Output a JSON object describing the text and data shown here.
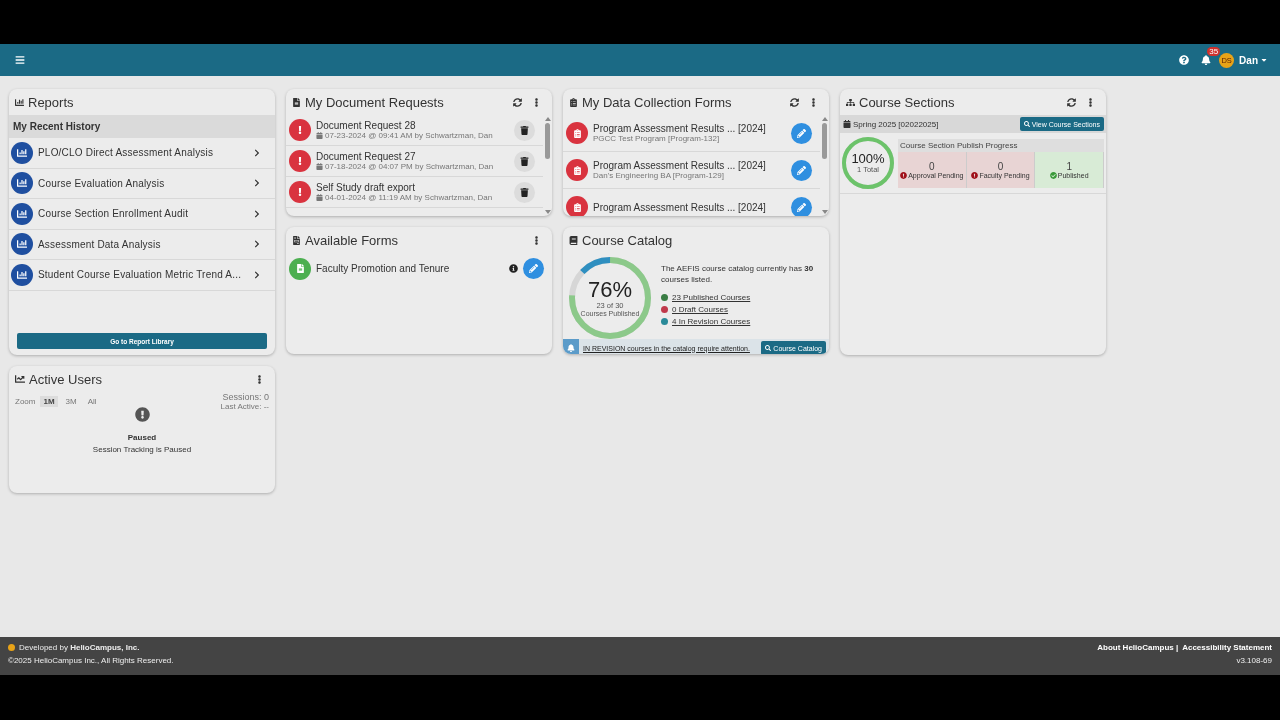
{
  "top_bar": {
    "notification_count": "35",
    "avatar_initials": "DS",
    "user_name": "Dan"
  },
  "reports": {
    "title": "Reports",
    "section": "My Recent History",
    "items": [
      {
        "label": "PLO/CLO Direct Assessment Analysis"
      },
      {
        "label": "Course Evaluation Analysis"
      },
      {
        "label": "Course Section Enrollment Audit"
      },
      {
        "label": "Assessment Data Analysis"
      },
      {
        "label": "Student Course Evaluation Metric Trend A..."
      }
    ],
    "button": "Go to Report Library"
  },
  "active_users": {
    "title": "Active Users",
    "zoom_label": "Zoom",
    "zoom_options": [
      {
        "label": "1M",
        "selected": true
      },
      {
        "label": "3M",
        "selected": false
      },
      {
        "label": "All",
        "selected": false
      }
    ],
    "sessions": "Sessions: 0",
    "last_active": "Last Active: --",
    "status": "Paused",
    "message": "Session Tracking is Paused"
  },
  "document_requests": {
    "title": "My Document Requests",
    "items": [
      {
        "title": "Document Request 28",
        "meta": "07-23-2024 @ 09:41 AM by Schwartzman, Dan"
      },
      {
        "title": "Document Request 27",
        "meta": "07-18-2024 @ 04:07 PM by Schwartzman, Dan"
      },
      {
        "title": "Self Study draft export",
        "meta": "04-01-2024 @ 11:19 AM by Schwartzman, Dan"
      }
    ]
  },
  "available_forms": {
    "title": "Available Forms",
    "items": [
      {
        "label": "Faculty Promotion and Tenure"
      }
    ]
  },
  "data_collection_forms": {
    "title": "My Data Collection Forms",
    "items": [
      {
        "title": "Program Assessment Results ... [2024]",
        "subtitle": "PGCC Test Program [Program-132]"
      },
      {
        "title": "Program Assessment Results ... [2024]",
        "subtitle": "Dan's Engineering BA [Program-129]"
      },
      {
        "title": "Program Assessment Results ... [2024]"
      }
    ]
  },
  "course_catalog": {
    "title": "Course Catalog",
    "percent": "76%",
    "count": "23 of 30",
    "count_label": "Courses Published",
    "level": 0.76,
    "revision_meter": {
      "level": 0.13
    },
    "summary": "The AEFIS course catalog currently has **30** courses listed.",
    "links": [
      {
        "label": "23 Published Courses",
        "color": "#3a7d44"
      },
      {
        "label": "0 Draft Courses",
        "color": "#c0394b"
      },
      {
        "label": "4 In Revision Courses",
        "color": "#2a8a99"
      }
    ],
    "alert": "IN REVISION courses in the catalog require attention.",
    "button": "Course Catalog"
  },
  "course_sections": {
    "title": "Course Sections",
    "term": "Spring 2025 [02022025]",
    "button": "View Course Sections",
    "percent": "100%",
    "total": "1 Total",
    "level": 1,
    "progress_title": "Course Section Publish Progress",
    "stages": [
      {
        "count": "0",
        "label": "Approval Pending",
        "kind": "pending"
      },
      {
        "count": "0",
        "label": "Faculty Pending",
        "kind": "pending"
      },
      {
        "count": "1",
        "label": "Published",
        "kind": "done"
      }
    ]
  },
  "footer": {
    "developed_by": "Developed by **HelioCampus, Inc.**",
    "copyright": "©2025 HelioCampus Inc., All Rights Reserved.",
    "links": [
      {
        "label": "About HelioCampus |"
      },
      {
        "label": "Accessibility Statement"
      }
    ],
    "version": "v3.108-69"
  }
}
